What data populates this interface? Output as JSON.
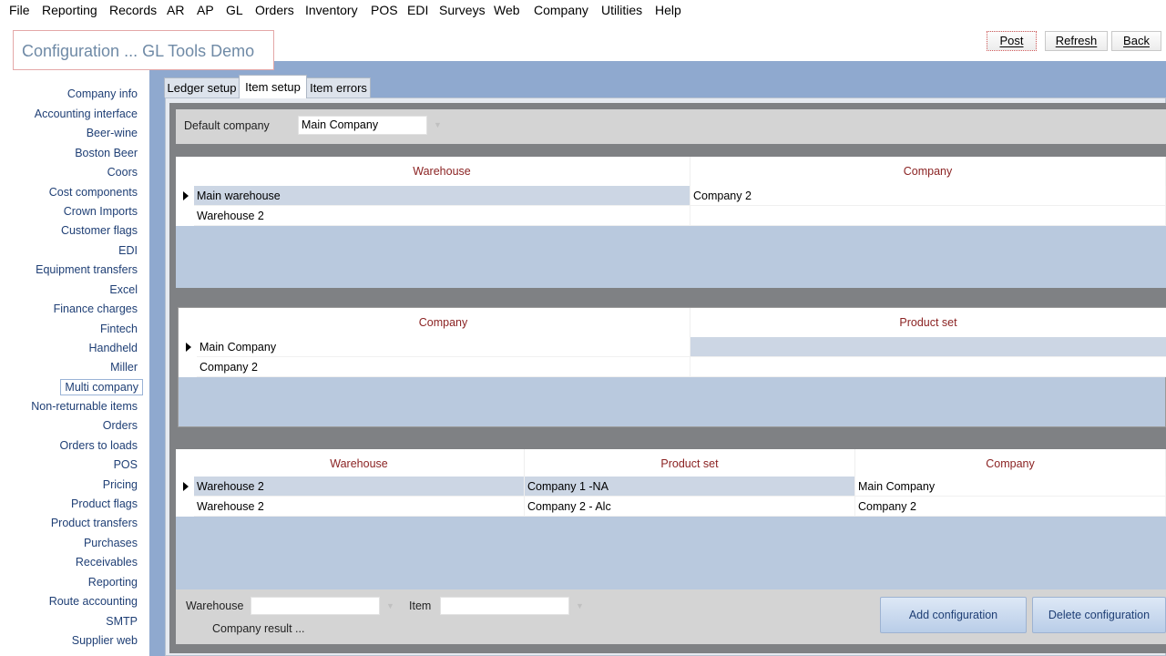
{
  "menu": [
    "File",
    "Reporting",
    "Records",
    "AR",
    "AP",
    "GL",
    "Orders",
    "Inventory",
    "POS",
    "EDI",
    "Surveys",
    "Web",
    "Company",
    "Utilities",
    "Help"
  ],
  "header": {
    "title": "Configuration ... GL Tools Demo"
  },
  "toolbar": {
    "post": "Post",
    "refresh": "Refresh",
    "back": "Back"
  },
  "nav": {
    "items": [
      "Company info",
      "Accounting interface",
      "Beer-wine",
      "Boston Beer",
      "Coors",
      "Cost components",
      "Crown Imports",
      "Customer flags",
      "EDI",
      "Equipment transfers",
      "Excel",
      "Finance charges",
      "Fintech",
      "Handheld",
      "Miller",
      "Multi company",
      "Non-returnable items",
      "Orders",
      "Orders to loads",
      "POS",
      "Pricing",
      "Product flags",
      "Product transfers",
      "Purchases",
      "Receivables",
      "Reporting",
      "Route accounting",
      "SMTP",
      "Supplier web"
    ],
    "selected": "Multi company"
  },
  "tabs": [
    "Ledger setup",
    "Item setup",
    "Item errors"
  ],
  "active_tab": "Item setup",
  "default_company": {
    "label": "Default company",
    "value": "Main Company"
  },
  "grid1": {
    "headers": [
      "Warehouse",
      "Company"
    ],
    "rows": [
      [
        "Main warehouse",
        "Company 2"
      ],
      [
        "Warehouse 2",
        ""
      ]
    ]
  },
  "grid2": {
    "headers": [
      "Company",
      "Product set"
    ],
    "rows": [
      [
        "Main Company",
        ""
      ],
      [
        "Company 2",
        ""
      ]
    ]
  },
  "grid3": {
    "headers": [
      "Warehouse",
      "Product set",
      "Company"
    ],
    "rows": [
      [
        "Warehouse 2",
        "Company 1 -NA",
        "Main Company"
      ],
      [
        "Warehouse 2",
        "Company 2 - Alc",
        "Company 2"
      ]
    ]
  },
  "filters": {
    "warehouse_label": "Warehouse",
    "warehouse_value": "",
    "item_label": "Item",
    "item_value": "",
    "result": "Company result ..."
  },
  "buttons": {
    "add": "Add configuration",
    "delete": "Delete configuration"
  }
}
